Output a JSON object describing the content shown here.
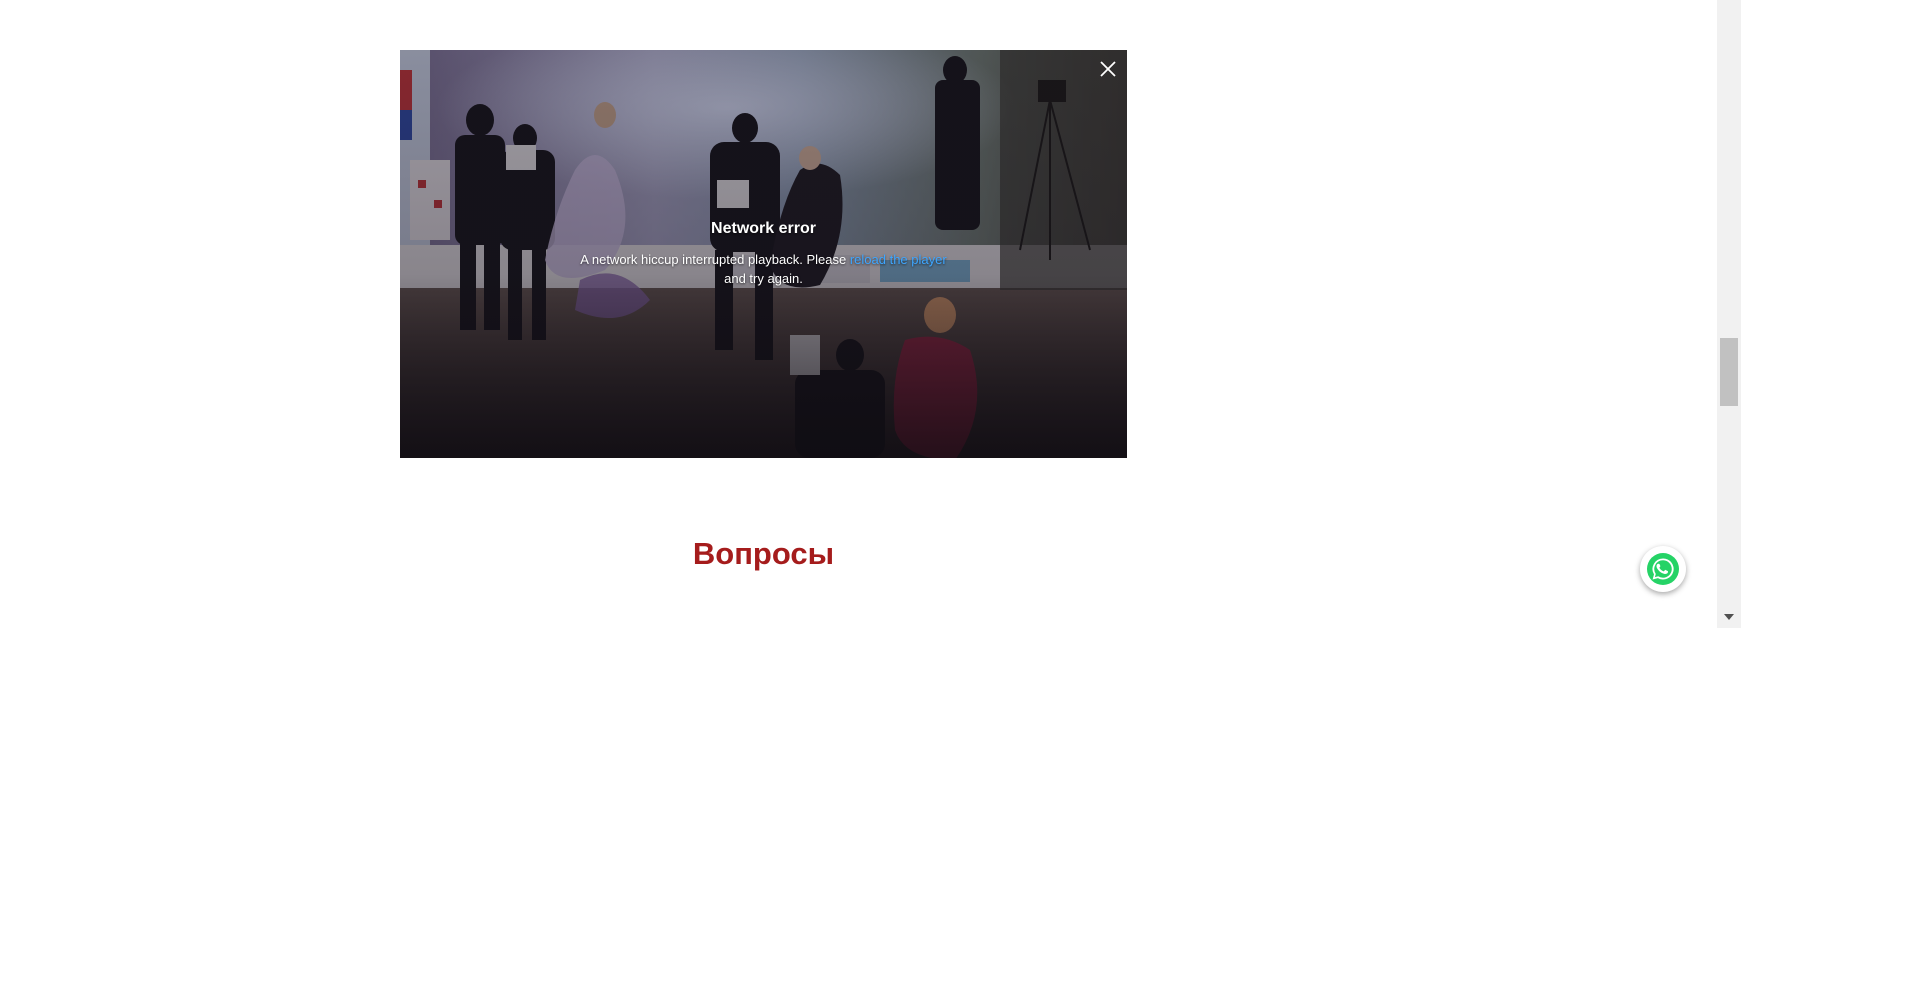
{
  "player": {
    "error_title": "Network error",
    "error_message_before": "A network hiccup interrupted playback. Please ",
    "error_link_text": "reload the player",
    "error_message_after": " and try again.",
    "close_icon": "close-icon",
    "link_color": "#3ea6ff"
  },
  "section": {
    "heading": "Вопросы",
    "heading_color": "#a51c1c"
  },
  "floating": {
    "whatsapp_icon": "whatsapp-icon",
    "whatsapp_color": "#25d366"
  },
  "scrollbar": {
    "down_arrow_icon": "chevron-down-icon"
  }
}
